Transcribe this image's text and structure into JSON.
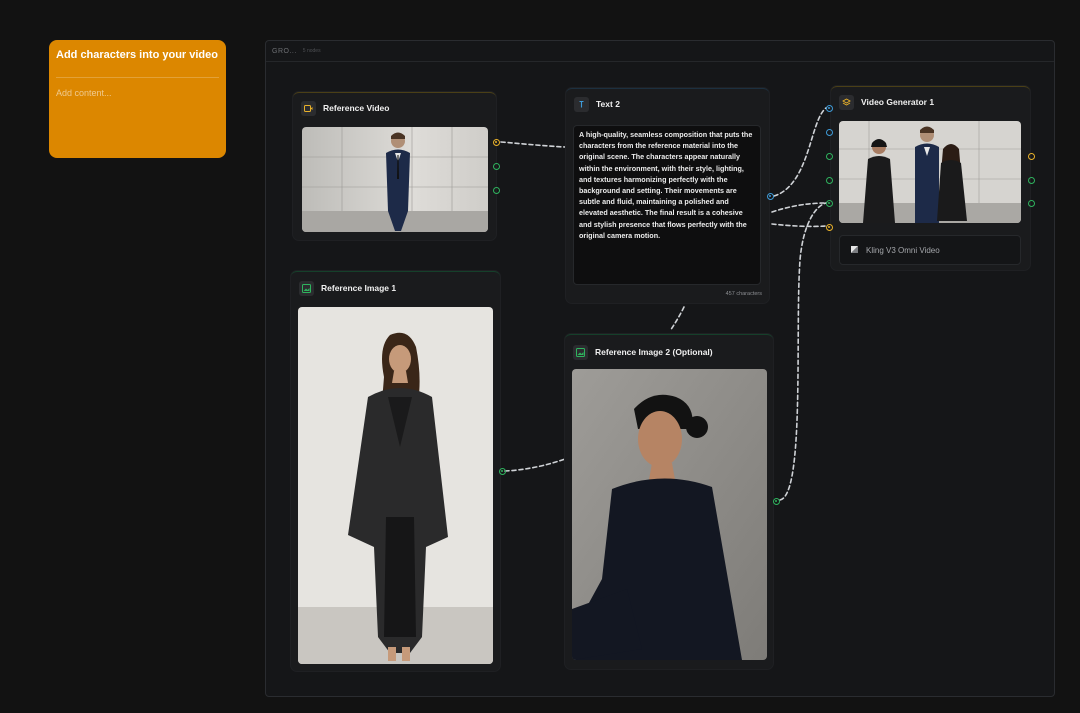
{
  "note": {
    "title": "Add characters into your video",
    "body_placeholder": "Add content..."
  },
  "group": {
    "name": "GRO...",
    "count": "5 nodes"
  },
  "nodes": {
    "reference_video": {
      "title": "Reference Video",
      "icon": "video-icon"
    },
    "reference_image_1": {
      "title": "Reference Image 1",
      "icon": "image-icon"
    },
    "text_2": {
      "title": "Text 2",
      "icon": "text-icon",
      "content": "A high-quality, seamless composition that puts the characters from the reference material into the original scene. The characters appear naturally within the environment, with their style, lighting, and textures harmonizing perfectly with the background and setting. Their movements are subtle and fluid, maintaining a polished and elevated aesthetic. The final result is a cohesive and stylish presence that flows perfectly with the original camera motion.",
      "char_count": "457 characters"
    },
    "reference_image_2": {
      "title": "Reference Image 2 (Optional)",
      "icon": "image-icon"
    },
    "video_generator": {
      "title": "Video Generator 1",
      "icon": "layers-icon",
      "model": "Kling V3 Omni Video"
    }
  },
  "colors": {
    "background": "#121212",
    "note": "#dc8700",
    "port_yellow": "#e8b12a",
    "port_green": "#2fb35e",
    "port_blue": "#3e9bd8",
    "wire": "#cfd2d6"
  }
}
